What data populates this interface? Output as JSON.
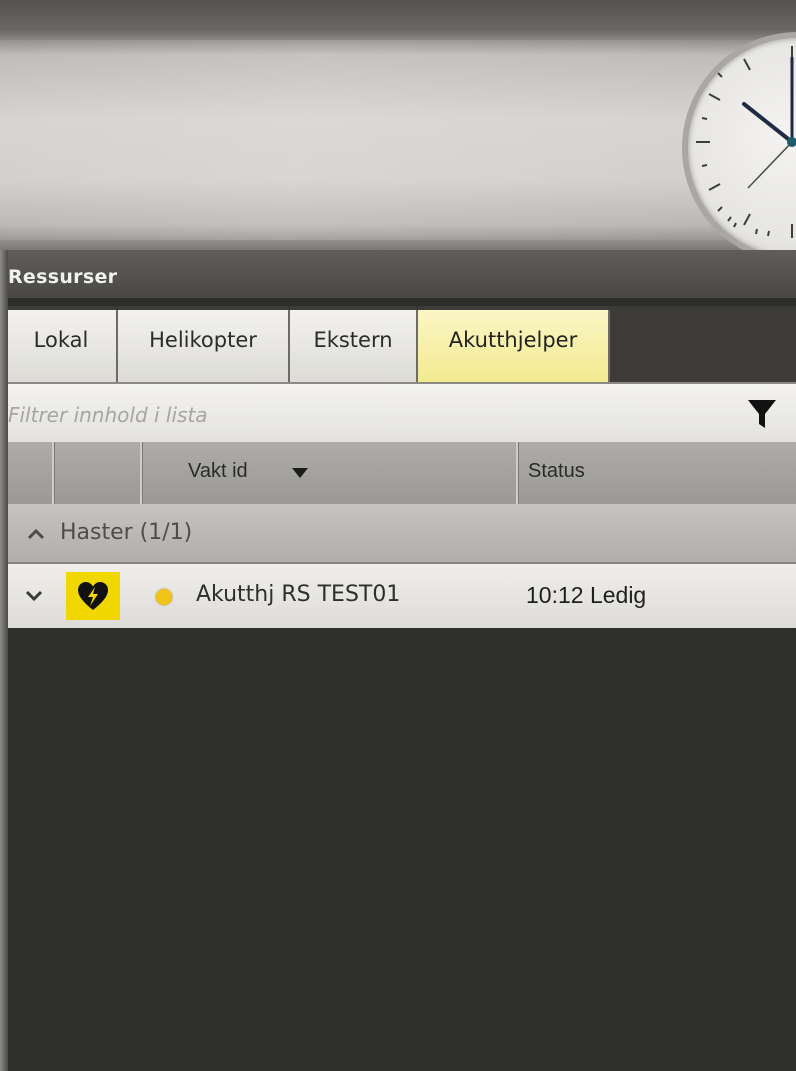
{
  "panel": {
    "title": "Ressurser"
  },
  "tabs": [
    {
      "label": "Lokal",
      "active": false
    },
    {
      "label": "Helikopter",
      "active": false
    },
    {
      "label": "Ekstern",
      "active": false
    },
    {
      "label": "Akutthjelper",
      "active": true
    }
  ],
  "filter": {
    "placeholder": "Filtrer innhold i lista",
    "value": "",
    "icon": "funnel-icon"
  },
  "columns": {
    "vakt_id": "Vakt id",
    "vakt_id_sort": "descending",
    "status": "Status"
  },
  "groups": [
    {
      "label": "Haster (1/1)",
      "expanded": true,
      "rows": [
        {
          "name": "Akutthj RS TEST01",
          "status": "10:12 Ledig",
          "type_icon": "heart-defibrillator-icon",
          "status_color": "#f1c419"
        }
      ]
    }
  ],
  "colors": {
    "active_tab": "#f2ea8f",
    "badge": "#f0d700"
  }
}
